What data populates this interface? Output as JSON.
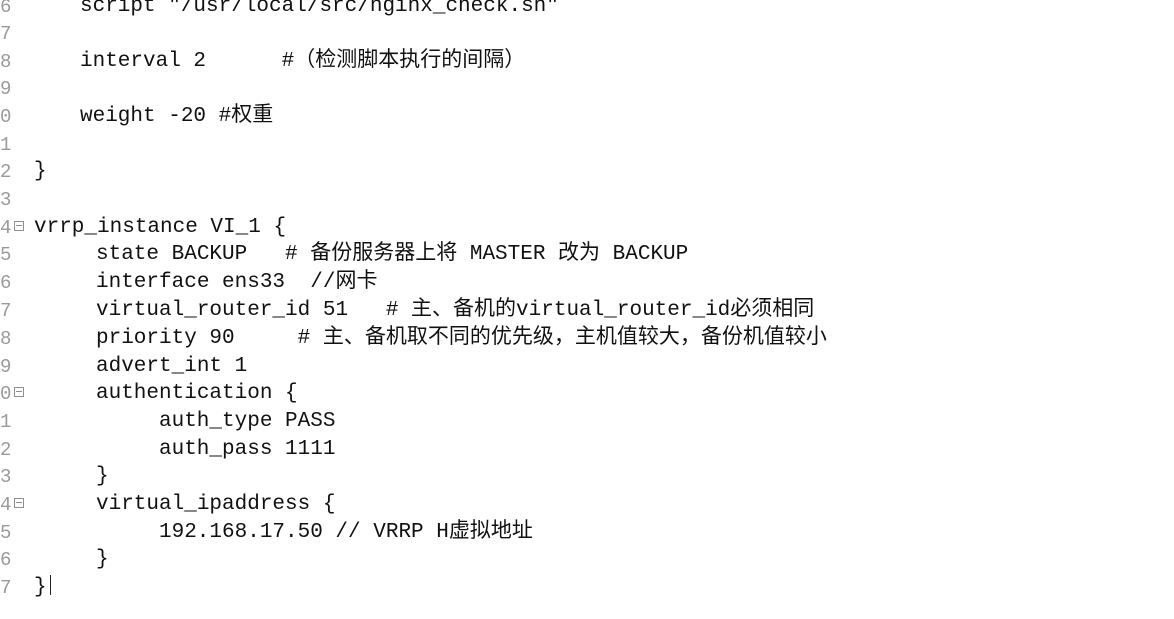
{
  "editor": {
    "lines": [
      {
        "number": "6",
        "text": "script \"/usr/local/src/nginx_check.sh\""
      },
      {
        "number": "7",
        "text": ""
      },
      {
        "number": "8",
        "text": "interval 2      #（检测脚本执行的间隔）"
      },
      {
        "number": "9",
        "text": ""
      },
      {
        "number": "0",
        "text": "weight -20 #权重"
      },
      {
        "number": "1",
        "text": ""
      },
      {
        "number": "2",
        "text": "}"
      },
      {
        "number": "3",
        "text": ""
      },
      {
        "number": "4",
        "text": "vrrp_instance VI_1 {"
      },
      {
        "number": "5",
        "text": "state BACKUP   # 备份服务器上将 MASTER 改为 BACKUP"
      },
      {
        "number": "6",
        "text": "interface ens33  //网卡"
      },
      {
        "number": "7",
        "text": "virtual_router_id 51   # 主、备机的virtual_router_id必须相同"
      },
      {
        "number": "8",
        "text": "priority 90     # 主、备机取不同的优先级，主机值较大，备份机值较小"
      },
      {
        "number": "9",
        "text": "advert_int 1"
      },
      {
        "number": "0",
        "text": "authentication {"
      },
      {
        "number": "1",
        "text": "auth_type PASS"
      },
      {
        "number": "2",
        "text": "auth_pass 1111"
      },
      {
        "number": "3",
        "text": "}"
      },
      {
        "number": "4",
        "text": "virtual_ipaddress {"
      },
      {
        "number": "5",
        "text": "192.168.17.50 // VRRP H虚拟地址"
      },
      {
        "number": "6",
        "text": "}"
      },
      {
        "number": "7",
        "text": "}"
      }
    ]
  }
}
